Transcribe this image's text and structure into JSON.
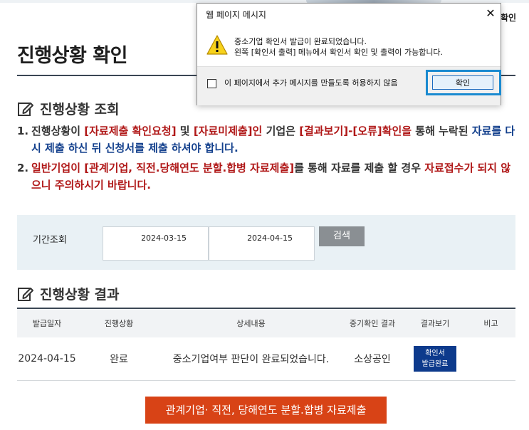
{
  "header": {
    "top_right_label": "확인"
  },
  "page": {
    "title": "진행상황 확인"
  },
  "status_section": {
    "heading": "진행상황 조회",
    "notes": [
      {
        "num": "1.",
        "parts": [
          {
            "text": "진행상황이 ",
            "style": "plain"
          },
          {
            "text": "[자료제출 확인요청]",
            "style": "red"
          },
          {
            "text": " 및 ",
            "style": "plain"
          },
          {
            "text": "[자료미제출]인",
            "style": "red"
          },
          {
            "text": " 기업은 ",
            "style": "plain"
          },
          {
            "text": "[결과보기]-[오류]확인을",
            "style": "red"
          },
          {
            "text": " 통해 누락된 ",
            "style": "plain"
          },
          {
            "text": "자료를 다시 제출 하신 뒤 신청서를 제출 하셔야 합니다.",
            "style": "blue"
          }
        ]
      },
      {
        "num": "2.",
        "parts": [
          {
            "text": "일반기업이 [관계기업, 직전.당해연도 분할.합병 자료제출]",
            "style": "red"
          },
          {
            "text": "를 통해 자료를 제출 할 경우 ",
            "style": "plain"
          },
          {
            "text": "자료접수가 되지 않으니 주의하시기 바랍니다.",
            "style": "red"
          }
        ]
      }
    ]
  },
  "filter": {
    "label": "기간조회",
    "start_date": "2024-03-15",
    "end_date": "2024-04-15",
    "search_label": "검색"
  },
  "result_section": {
    "heading": "진행상황 결과",
    "columns": [
      "발급일자",
      "진행상황",
      "상세내용",
      "중기확인 결과",
      "결과보기",
      "비고"
    ],
    "rows": [
      {
        "date": "2024-04-15",
        "status": "완료",
        "detail": "중소기업여부 판단이 완료되었습니다.",
        "result": "소상공인",
        "view_line1": "확인서",
        "view_line2": "발급완료",
        "note": ""
      }
    ]
  },
  "submit_button": {
    "label": "관계기업· 직전, 당해연도 분할.합병 자료제출"
  },
  "dialog": {
    "title": "웹 페이지 메시지",
    "close_glyph": "✕",
    "message_line1": "중소기업 확인서 발급이 완료되었습니다.",
    "message_line2": "왼쪽 [확인서 출력] 메뉴에서 확인서 확인 및 출력이 가능합니다.",
    "checkbox_label": "이 페이지에서 추가 메시지를 만들도록 허용하지 않음",
    "ok_label": "확인",
    "icon": "warning-icon"
  },
  "colors": {
    "accent_red": "#b01818",
    "accent_blue": "#123f8c",
    "submit_orange": "#d84316",
    "cert_button": "#0d3a8c"
  }
}
